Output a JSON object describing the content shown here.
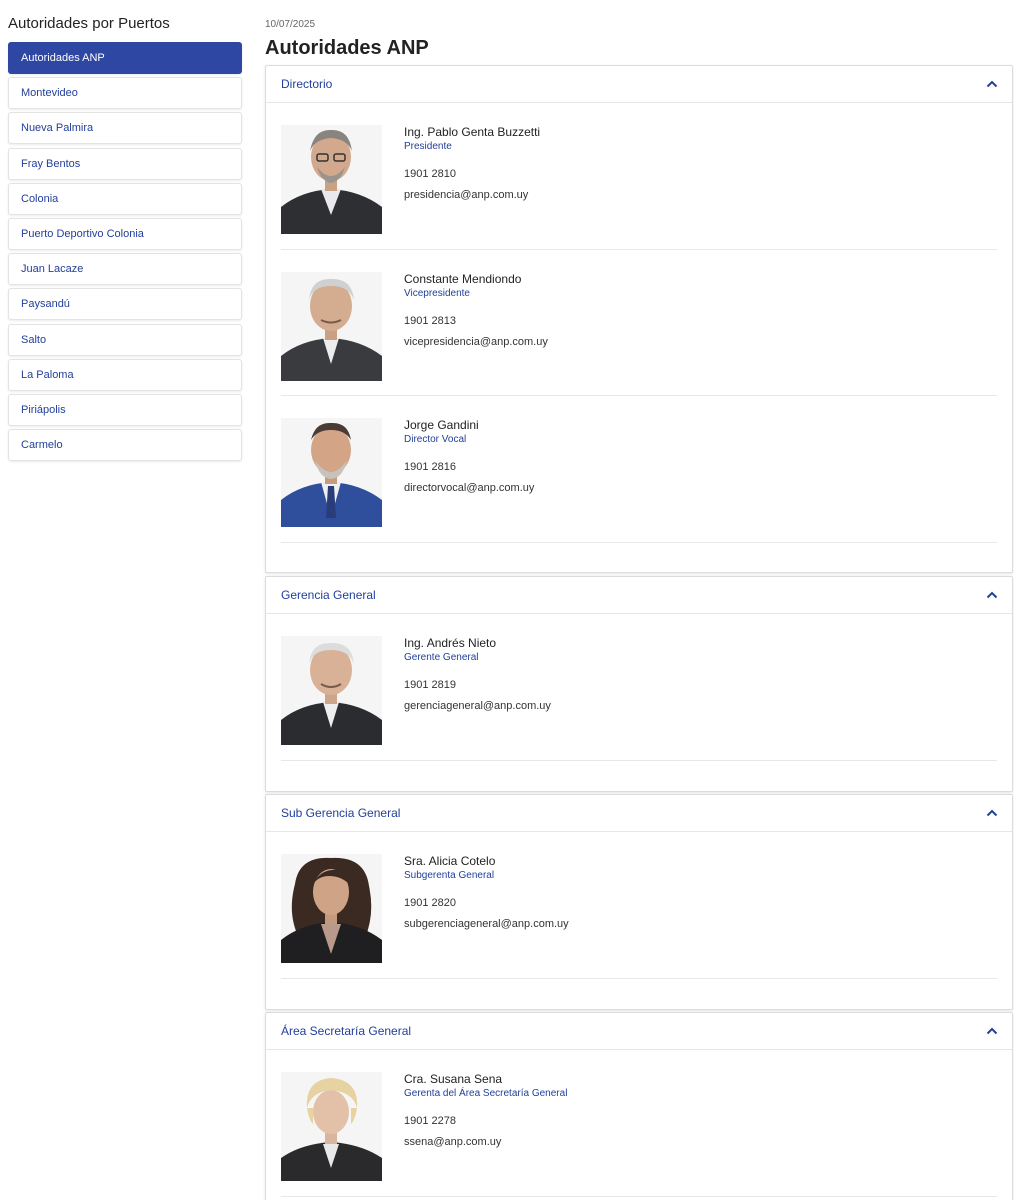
{
  "sidebar": {
    "title": "Autoridades por Puertos",
    "items": [
      {
        "label": "Autoridades ANP",
        "active": true
      },
      {
        "label": "Montevideo"
      },
      {
        "label": "Nueva Palmira"
      },
      {
        "label": "Fray Bentos"
      },
      {
        "label": "Colonia"
      },
      {
        "label": "Puerto Deportivo Colonia"
      },
      {
        "label": "Juan Lacaze"
      },
      {
        "label": "Paysandú"
      },
      {
        "label": "Salto"
      },
      {
        "label": "La Paloma"
      },
      {
        "label": "Piriápolis"
      },
      {
        "label": "Carmelo"
      }
    ]
  },
  "main": {
    "date": "10/07/2025",
    "title": "Autoridades ANP",
    "sections": [
      {
        "title": "Directorio",
        "people": [
          {
            "name": "Ing. Pablo Genta Buzzetti",
            "role": "Presidente",
            "phone": "1901 2810",
            "email": "presidencia@anp.com.uy",
            "icon": "portrait-photo-icon"
          },
          {
            "name": "Constante Mendiondo",
            "role": "Vicepresidente",
            "phone": "1901 2813",
            "email": "vicepresidencia@anp.com.uy",
            "icon": "portrait-photo-icon"
          },
          {
            "name": "Jorge Gandini",
            "role": "Director Vocal",
            "phone": "1901 2816",
            "email": "directorvocal@anp.com.uy",
            "icon": "portrait-photo-icon"
          }
        ]
      },
      {
        "title": "Gerencia General",
        "people": [
          {
            "name": "Ing. Andrés Nieto",
            "role": "Gerente General",
            "phone": "1901 2819",
            "email": "gerenciageneral@anp.com.uy",
            "icon": "portrait-photo-icon"
          }
        ]
      },
      {
        "title": "Sub Gerencia General",
        "people": [
          {
            "name": "Sra. Alicia Cotelo",
            "role": "Subgerenta General",
            "phone": "1901 2820",
            "email": "subgerenciageneral@anp.com.uy",
            "icon": "portrait-photo-icon"
          }
        ]
      },
      {
        "title": "Área Secretaría General",
        "people": [
          {
            "name": "Cra. Susana Sena",
            "role": "Gerenta del Área Secretaría General",
            "phone": "1901 2278",
            "email": "ssena@anp.com.uy",
            "icon": "portrait-photo-icon"
          }
        ]
      }
    ]
  },
  "colors": {
    "accent": "#2d47a3",
    "link": "#23409a"
  },
  "icons": {
    "collapse": "chevron-up-icon"
  }
}
